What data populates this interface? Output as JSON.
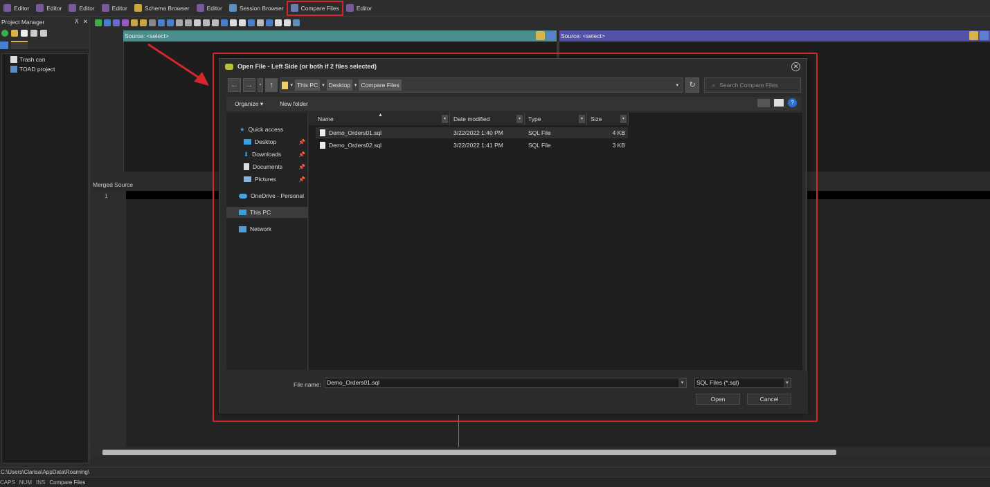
{
  "tabs": [
    "Editor",
    "Editor",
    "Editor",
    "Editor",
    "Schema Browser",
    "Editor",
    "Session Browser",
    "Compare Files",
    "Editor"
  ],
  "project_manager": {
    "title": "Project Manager",
    "pin": "⊼",
    "close": "✕",
    "items": [
      "Trash can",
      "TOAD project"
    ]
  },
  "compare": {
    "left_source": "Source: <select>",
    "right_source": "Source: <select>",
    "merged_label": "Merged Source",
    "line_number": "1"
  },
  "dialog": {
    "title": "Open File - Left Side (or both if 2 files selected)",
    "close": "✕",
    "breadcrumbs": [
      "This PC",
      "Desktop",
      "Compare Files"
    ],
    "search_placeholder": "Search Compare Files",
    "organize": "Organize",
    "new_folder": "New folder",
    "nav": {
      "quick_access": "Quick access",
      "desktop": "Desktop",
      "downloads": "Downloads",
      "documents": "Documents",
      "pictures": "Pictures",
      "onedrive": "OneDrive - Personal",
      "this_pc": "This PC",
      "network": "Network"
    },
    "columns": [
      "Name",
      "Date modified",
      "Type",
      "Size"
    ],
    "files": [
      {
        "name": "Demo_Orders01.sql",
        "date": "3/22/2022 1:40 PM",
        "type": "SQL File",
        "size": "4 KB"
      },
      {
        "name": "Demo_Orders02.sql",
        "date": "3/22/2022 1:41 PM",
        "type": "SQL File",
        "size": "3 KB"
      }
    ],
    "file_name_label": "File name:",
    "file_name_value": "Demo_Orders01.sql",
    "filter": "SQL Files (*.sql)",
    "open": "Open",
    "cancel": "Cancel"
  },
  "status": {
    "path": "C:\\Users\\Clarisa\\AppData\\Roaming\\",
    "caps": "CAPS",
    "num": "NUM",
    "ins": "INS",
    "mode": "Compare Files"
  },
  "colors": {
    "highlight": "#d4262b",
    "left_source_bar": "#4a8f8e",
    "right_source_bar": "#5451a8"
  }
}
